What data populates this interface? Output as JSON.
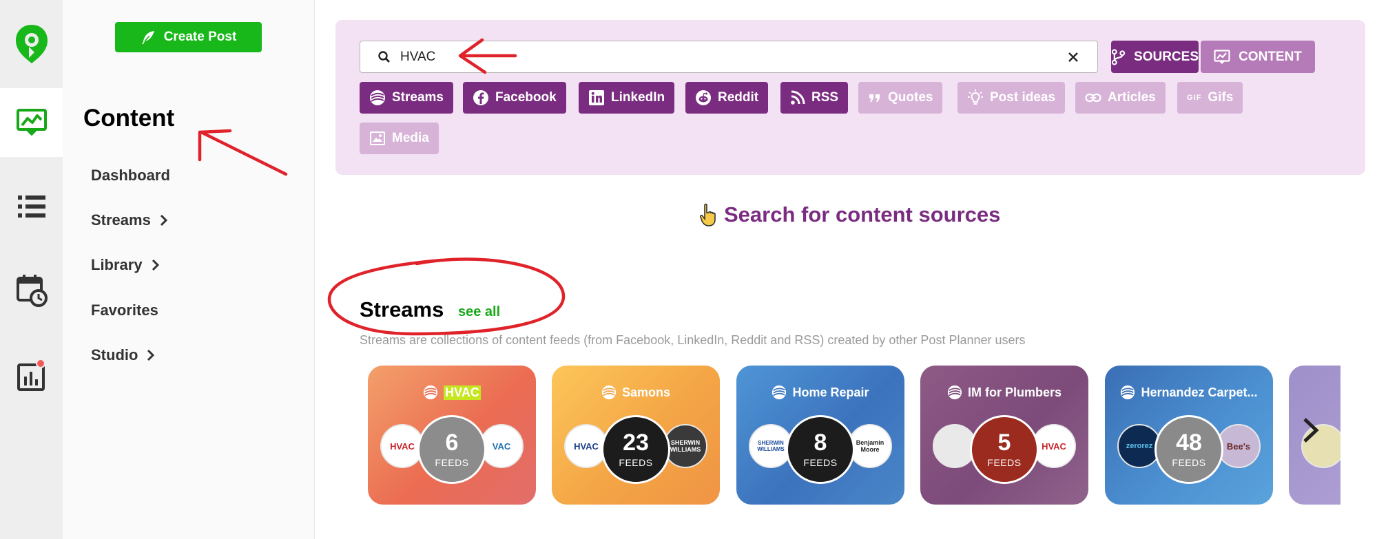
{
  "sidebar_rail": {
    "items": [
      {
        "icon": "post-planner-logo-icon"
      },
      {
        "icon": "content-chart-icon",
        "active": true
      },
      {
        "icon": "list-icon"
      },
      {
        "icon": "calendar-clock-icon"
      },
      {
        "icon": "analytics-icon",
        "badge": true
      }
    ]
  },
  "sidenav": {
    "create_label": "Create Post",
    "title": "Content",
    "items": [
      {
        "label": "Dashboard",
        "chevron": false
      },
      {
        "label": "Streams",
        "chevron": true
      },
      {
        "label": "Library",
        "chevron": true
      },
      {
        "label": "Favorites",
        "chevron": false
      },
      {
        "label": "Studio",
        "chevron": true
      }
    ]
  },
  "search": {
    "value": "HVAC",
    "placeholder": ""
  },
  "modes": {
    "sources_label": "SOURCES",
    "content_label": "CONTENT"
  },
  "filters": [
    {
      "label": "Streams",
      "icon": "streams-icon",
      "active": true
    },
    {
      "label": "Facebook",
      "icon": "facebook-icon",
      "active": true
    },
    {
      "label": "LinkedIn",
      "icon": "linkedin-icon",
      "active": true
    },
    {
      "label": "Reddit",
      "icon": "reddit-icon",
      "active": true
    },
    {
      "label": "RSS",
      "icon": "rss-icon",
      "active": true
    },
    {
      "label": "Quotes",
      "icon": "quote-icon",
      "active": false
    },
    {
      "label": "Post ideas",
      "icon": "lightbulb-icon",
      "active": false
    },
    {
      "label": "Articles",
      "icon": "link-icon",
      "active": false
    },
    {
      "label": "Gifs",
      "icon": "gif-icon",
      "active": false
    },
    {
      "label": "Media",
      "icon": "image-icon",
      "active": false
    }
  ],
  "hero": {
    "text": "Search for content sources"
  },
  "streams_section": {
    "title": "Streams",
    "see_all": "see all",
    "description": "Streams are collections of content feeds (from Facebook, LinkedIn, Reddit and RSS) created by other Post Planner users"
  },
  "stream_cards": [
    {
      "title": "HVAC",
      "highlight": true,
      "count": "6",
      "feeds_label": "FEEDS",
      "left_thumb": "HVAC",
      "right_thumb": "VAC"
    },
    {
      "title": "Samons",
      "highlight": false,
      "count": "23",
      "feeds_label": "FEEDS",
      "left_thumb": "HVAC",
      "right_thumb": "SHERWIN WILLIAMS"
    },
    {
      "title": "Home Repair",
      "highlight": false,
      "count": "8",
      "feeds_label": "FEEDS",
      "left_thumb": "SHERWIN WILLIAMS",
      "right_thumb": "Benjamin Moore"
    },
    {
      "title": "IM for Plumbers",
      "highlight": false,
      "count": "5",
      "feeds_label": "FEEDS",
      "left_thumb": "",
      "right_thumb": "HVAC"
    },
    {
      "title": "Hernandez Carpet...",
      "highlight": false,
      "count": "48",
      "feeds_label": "FEEDS",
      "left_thumb": "zerorez",
      "right_thumb": "Bee's"
    }
  ],
  "colors": {
    "brand_green": "#18b81a",
    "brand_purple": "#7a2d80",
    "chip_disabled": "#d7b3d8",
    "panel_bg": "#f3e2f3"
  }
}
